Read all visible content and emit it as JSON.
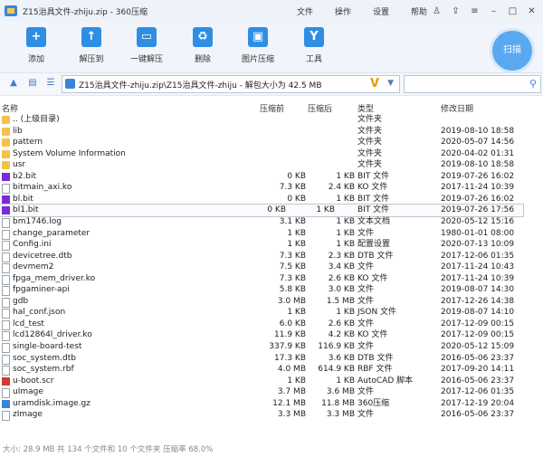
{
  "window": {
    "title": "Z15治具文件-zhiju.zip - 360压缩"
  },
  "menu": [
    "文件",
    "操作",
    "设置",
    "帮助"
  ],
  "toolbar": {
    "tools": [
      {
        "label": "添加",
        "icon": "add-icon"
      },
      {
        "label": "解压到",
        "icon": "extract-to-icon"
      },
      {
        "label": "一键解压",
        "icon": "one-click-extract-icon"
      },
      {
        "label": "删除",
        "icon": "delete-icon"
      },
      {
        "label": "图片压缩",
        "icon": "image-compress-icon"
      },
      {
        "label": "工具",
        "icon": "tools-icon"
      }
    ],
    "scan_label": "扫描"
  },
  "address": {
    "path": "Z15治具文件-zhiju.zip\\Z15治具文件-zhiju - 解包大小为 42.5 MB"
  },
  "columns": {
    "name": "名称",
    "size": "压缩前",
    "packed": "压缩后",
    "type": "类型",
    "modified": "修改日期"
  },
  "files": [
    {
      "icon": "folder",
      "name": ".. (上级目录)",
      "size": "",
      "packed": "",
      "type": "文件夹",
      "modified": ""
    },
    {
      "icon": "folder",
      "name": "lib",
      "size": "",
      "packed": "",
      "type": "文件夹",
      "modified": "2019-08-10 18:58"
    },
    {
      "icon": "folder",
      "name": "pattern",
      "size": "",
      "packed": "",
      "type": "文件夹",
      "modified": "2020-05-07 14:56"
    },
    {
      "icon": "folder",
      "name": "System Volume Information",
      "size": "",
      "packed": "",
      "type": "文件夹",
      "modified": "2020-04-02 01:31"
    },
    {
      "icon": "folder",
      "name": "usr",
      "size": "",
      "packed": "",
      "type": "文件夹",
      "modified": "2019-08-10 18:58"
    },
    {
      "icon": "hex",
      "name": "b2.bit",
      "size": "0 KB",
      "packed": "1 KB",
      "type": "BIT 文件",
      "modified": "2019-07-26 16:02"
    },
    {
      "icon": "file",
      "name": "bitmain_axi.ko",
      "size": "7.3 KB",
      "packed": "2.4 KB",
      "type": "KO 文件",
      "modified": "2017-11-24 10:39"
    },
    {
      "icon": "hex",
      "name": "bl.bit",
      "size": "0 KB",
      "packed": "1 KB",
      "type": "BIT 文件",
      "modified": "2019-07-26 16:02"
    },
    {
      "icon": "hex",
      "name": "bl1.bit",
      "size": "0 KB",
      "packed": "1 KB",
      "type": "BIT 文件",
      "modified": "2019-07-26 17:56"
    },
    {
      "icon": "file",
      "name": "bm1746.log",
      "size": "3.1 KB",
      "packed": "1 KB",
      "type": "文本文档",
      "modified": "2020-05-12 15:16"
    },
    {
      "icon": "file",
      "name": "change_parameter",
      "size": "1 KB",
      "packed": "1 KB",
      "type": "文件",
      "modified": "1980-01-01 08:00"
    },
    {
      "icon": "file",
      "name": "Config.ini",
      "size": "1 KB",
      "packed": "1 KB",
      "type": "配置设置",
      "modified": "2020-07-13 10:09"
    },
    {
      "icon": "file",
      "name": "devicetree.dtb",
      "size": "7.3 KB",
      "packed": "2.3 KB",
      "type": "DTB 文件",
      "modified": "2017-12-06 01:35"
    },
    {
      "icon": "file",
      "name": "devmem2",
      "size": "7.5 KB",
      "packed": "3.4 KB",
      "type": "文件",
      "modified": "2017-11-24 10:43"
    },
    {
      "icon": "file",
      "name": "fpga_mem_driver.ko",
      "size": "7.3 KB",
      "packed": "2.6 KB",
      "type": "KO 文件",
      "modified": "2017-11-24 10:39"
    },
    {
      "icon": "file",
      "name": "fpgaminer-api",
      "size": "5.8 KB",
      "packed": "3.0 KB",
      "type": "文件",
      "modified": "2019-08-07 14:30"
    },
    {
      "icon": "file",
      "name": "gdb",
      "size": "3.0 MB",
      "packed": "1.5 MB",
      "type": "文件",
      "modified": "2017-12-26 14:38"
    },
    {
      "icon": "file",
      "name": "hal_conf.json",
      "size": "1 KB",
      "packed": "1 KB",
      "type": "JSON 文件",
      "modified": "2019-08-07 14:10"
    },
    {
      "icon": "file",
      "name": "lcd_test",
      "size": "6.0 KB",
      "packed": "2.6 KB",
      "type": "文件",
      "modified": "2017-12-09 00:15"
    },
    {
      "icon": "file",
      "name": "lcd12864l_driver.ko",
      "size": "11.9 KB",
      "packed": "4.2 KB",
      "type": "KO 文件",
      "modified": "2017-12-09 00:15"
    },
    {
      "icon": "file",
      "name": "single-board-test",
      "size": "337.9 KB",
      "packed": "116.9 KB",
      "type": "文件",
      "modified": "2020-05-12 15:09"
    },
    {
      "icon": "file",
      "name": "soc_system.dtb",
      "size": "17.3 KB",
      "packed": "3.6 KB",
      "type": "DTB 文件",
      "modified": "2016-05-06 23:37"
    },
    {
      "icon": "file",
      "name": "soc_system.rbf",
      "size": "4.0 MB",
      "packed": "614.9 KB",
      "type": "RBF 文件",
      "modified": "2017-09-20 14:11"
    },
    {
      "icon": "acad",
      "name": "u-boot.scr",
      "size": "1 KB",
      "packed": "1 KB",
      "type": "AutoCAD 脚本",
      "modified": "2016-05-06 23:37"
    },
    {
      "icon": "file",
      "name": "uImage",
      "size": "3.7 MB",
      "packed": "3.6 MB",
      "type": "文件",
      "modified": "2017-12-06 01:35"
    },
    {
      "icon": "360",
      "name": "uramdisk.image.gz",
      "size": "12.1 MB",
      "packed": "11.8 MB",
      "type": "360压缩",
      "modified": "2017-12-19 20:04"
    },
    {
      "icon": "file",
      "name": "zImage",
      "size": "3.3 MB",
      "packed": "3.3 MB",
      "type": "文件",
      "modified": "2016-05-06 23:37"
    }
  ],
  "selected_index": 8,
  "status": {
    "text": "大小: 28.9 MB 共 134 个文件和 10 个文件夹 压缩率 68.0%"
  }
}
